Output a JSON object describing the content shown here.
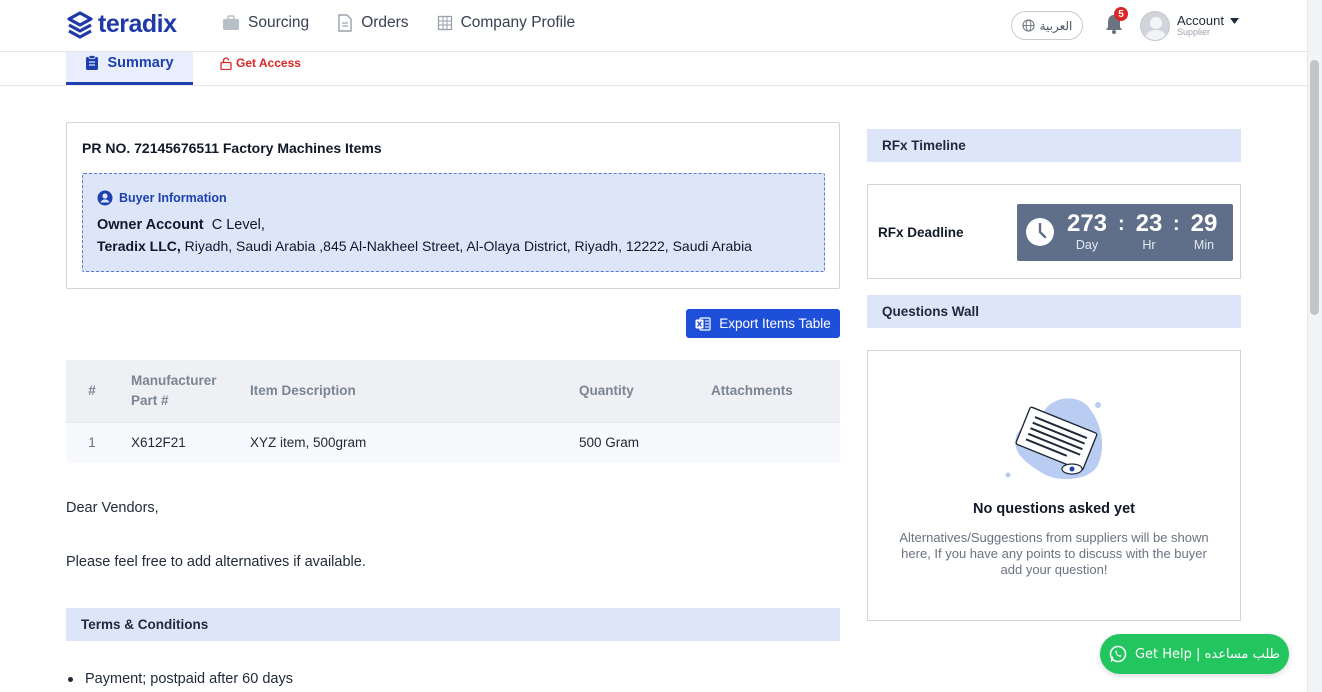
{
  "header": {
    "logo": "teradix",
    "nav": [
      {
        "label": "Sourcing",
        "icon": "briefcase-icon"
      },
      {
        "label": "Orders",
        "icon": "document-icon"
      },
      {
        "label": "Company Profile",
        "icon": "building-icon"
      }
    ],
    "language": "العربية",
    "notifications_count": "5",
    "account_name": "Account",
    "account_role": "Supplier"
  },
  "tabs": {
    "summary": "Summary",
    "get_access": "Get Access"
  },
  "pr": {
    "title": "PR NO. 72145676511 Factory Machines Items",
    "buyer_heading": "Buyer Information",
    "owner_label": "Owner Account",
    "owner_value": "C Level,",
    "company": "Teradix LLC,",
    "address": "Riyadh, Saudi Arabia ,845 Al-Nakheel Street, Al-Olaya District, Riyadh, 12222, Saudi Arabia"
  },
  "export_button": "Export Items Table",
  "table": {
    "headers": [
      "#",
      "Manufacturer Part #",
      "Item Description",
      "Quantity",
      "Attachments"
    ],
    "rows": [
      [
        "1",
        "X612F21",
        "XYZ item, 500gram",
        "500 Gram",
        ""
      ]
    ]
  },
  "letter": {
    "greeting": "Dear Vendors,",
    "body": "Please feel free to add alternatives if available."
  },
  "terms": {
    "heading": "Terms & Conditions",
    "items": [
      "Payment; postpaid after 60 days"
    ]
  },
  "timeline": {
    "heading": "RFx Timeline",
    "deadline_label": "RFx Deadline",
    "days": "273",
    "days_label": "Day",
    "hours": "23",
    "hours_label": "Hr",
    "minutes": "29",
    "minutes_label": "Min"
  },
  "questions": {
    "heading": "Questions Wall",
    "empty_title": "No questions asked yet",
    "empty_desc": "Alternatives/Suggestions from suppliers will be shown here, If you have any points to discuss with the buyer add your question!"
  },
  "help_button": "Get Help | طلب مساعده",
  "colors": {
    "brand": "#1e3aa8",
    "accent_blue": "#1e4fd8",
    "panel_blue": "#dce6f8",
    "timer_bg": "#5f6f8a",
    "help_green": "#22c55e",
    "danger": "#dc2626"
  }
}
